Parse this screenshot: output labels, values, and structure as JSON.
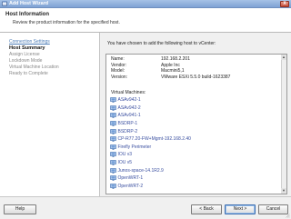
{
  "window": {
    "title": "Add Host Wizard",
    "close_label": "X"
  },
  "header": {
    "title": "Host Information",
    "description": "Review the product information for the specified host."
  },
  "steps": [
    {
      "label": "Connection Settings",
      "state": "done"
    },
    {
      "label": "Host Summary",
      "state": "current"
    },
    {
      "label": "Assign License",
      "state": "pending"
    },
    {
      "label": "Lockdown Mode",
      "state": "pending"
    },
    {
      "label": "Virtual Machine Location",
      "state": "pending"
    },
    {
      "label": "Ready to Complete",
      "state": "pending"
    }
  ],
  "summary": {
    "intro": "You have chosen to add the following host to vCenter:",
    "properties": [
      {
        "key": "Name:",
        "value": "192.168.2.201"
      },
      {
        "key": "Vendor:",
        "value": "Apple Inc"
      },
      {
        "key": "Model:",
        "value": "Macmini5,1"
      },
      {
        "key": "Version:",
        "value": "VMware ESXi 5.5.0 build-1623387"
      }
    ],
    "vm_heading": "Virtual Machines:",
    "vms": [
      "ASAv942-1",
      "ASAv942-2",
      "ASAv941-1",
      "BSDRP-1",
      "BSDRP-2",
      "CP-R77.20-FW+Mgmt-192.168.2.40",
      "Firefly Perimeter",
      "IOU v3",
      "IOU v5",
      "Junos-space-14.1R2.9",
      "OpenWRT-1",
      "OpenWRT-2"
    ]
  },
  "buttons": {
    "help": "Help",
    "back": "< Back",
    "next": "Next >",
    "cancel": "Cancel"
  }
}
